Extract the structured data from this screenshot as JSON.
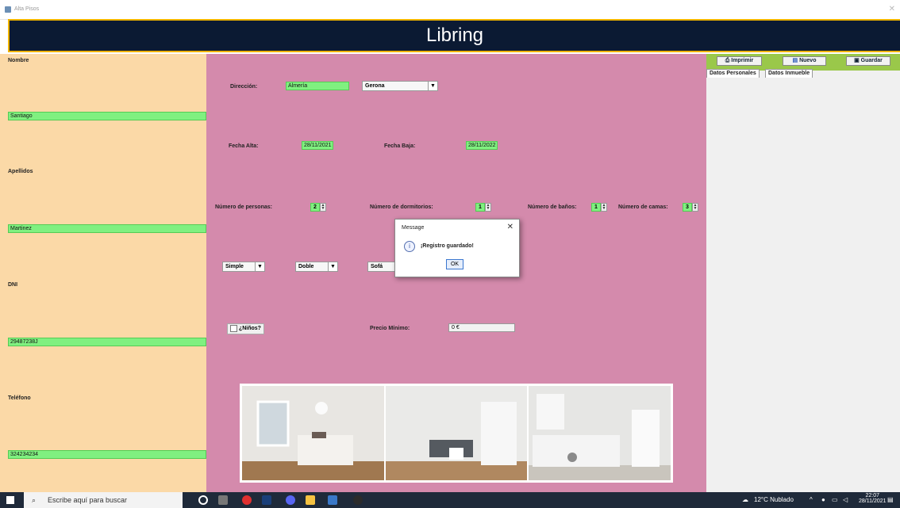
{
  "window": {
    "title": "Alta Pisos",
    "icon": "java-cup-icon"
  },
  "header": {
    "title": "Libring"
  },
  "left_panel": {
    "nombre_label": "Nombre",
    "nombre_value": "Santiago",
    "apellidos_label": "Apellidos",
    "apellidos_value": "Martinez",
    "dni_label": "DNI",
    "dni_value": "29487238J",
    "telefono_label": "Teléfono",
    "telefono_value": "324234234"
  },
  "form": {
    "direccion_label": "Dirección:",
    "direccion_value": "Almería",
    "provincia_value": "Gerona",
    "fecha_alta_label": "Fecha Alta:",
    "fecha_alta_value": "28/11/2021",
    "fecha_baja_label": "Fecha Baja:",
    "fecha_baja_value": "28/11/2022",
    "personas_label": "Número de personas:",
    "personas_value": "2",
    "dormitorios_label": "Número de dormitorios:",
    "dormitorios_value": "1",
    "banos_label": "Número de baños:",
    "banos_value": "1",
    "camas_label": "Número de camas:",
    "camas_value": "3",
    "cama1_value": "Simple",
    "cama2_value": "Doble",
    "cama3_value": "Sofá",
    "ninos_label": "¿Niños?",
    "precio_label": "Precio Mínimo:",
    "precio_value": "0 €"
  },
  "right_panel": {
    "imprimir_label": "Imprimir",
    "nuevo_label": "Nuevo",
    "guardar_label": "Guardar",
    "tabs": [
      "Datos Personales",
      "Datos Inmueble"
    ]
  },
  "dialog": {
    "title": "Message",
    "message": "¡Registro guardado!",
    "ok_label": "OK",
    "icon": "info-icon"
  },
  "taskbar": {
    "search_placeholder": "Escribe aquí para buscar",
    "weather": "12°C  Nublado",
    "time": "22:07",
    "date": "28/11/2021"
  },
  "colors": {
    "header_bg": "#0b1a33",
    "header_border": "#f0b400",
    "left_bg": "#fbd9a7",
    "main_bg": "#d48aac",
    "field_green": "#80f080",
    "toolbar_green": "#9ac84a"
  }
}
